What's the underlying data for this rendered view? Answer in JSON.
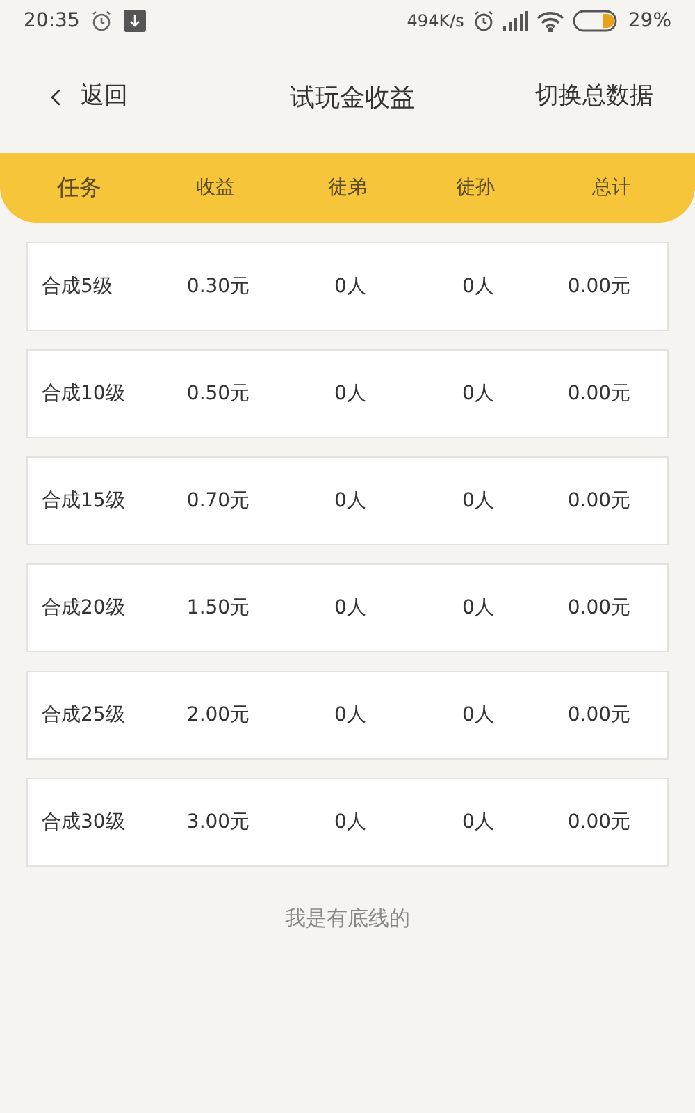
{
  "status_bar": {
    "time": "20:35",
    "network_speed": "494K/s",
    "battery_percent": "29%"
  },
  "nav": {
    "back": "返回",
    "title": "试玩金收益",
    "action": "切换总数据"
  },
  "table": {
    "columns": [
      "任务",
      "收益",
      "徒弟",
      "徒孙",
      "总计"
    ],
    "rows": [
      [
        "合成5级",
        "0.30元",
        "0人",
        "0人",
        "0.00元"
      ],
      [
        "合成10级",
        "0.50元",
        "0人",
        "0人",
        "0.00元"
      ],
      [
        "合成15级",
        "0.70元",
        "0人",
        "0人",
        "0.00元"
      ],
      [
        "合成20级",
        "1.50元",
        "0人",
        "0人",
        "0.00元"
      ],
      [
        "合成25级",
        "2.00元",
        "0人",
        "0人",
        "0.00元"
      ],
      [
        "合成30级",
        "3.00元",
        "0人",
        "0人",
        "0.00元"
      ]
    ]
  },
  "footer": "我是有底线的"
}
